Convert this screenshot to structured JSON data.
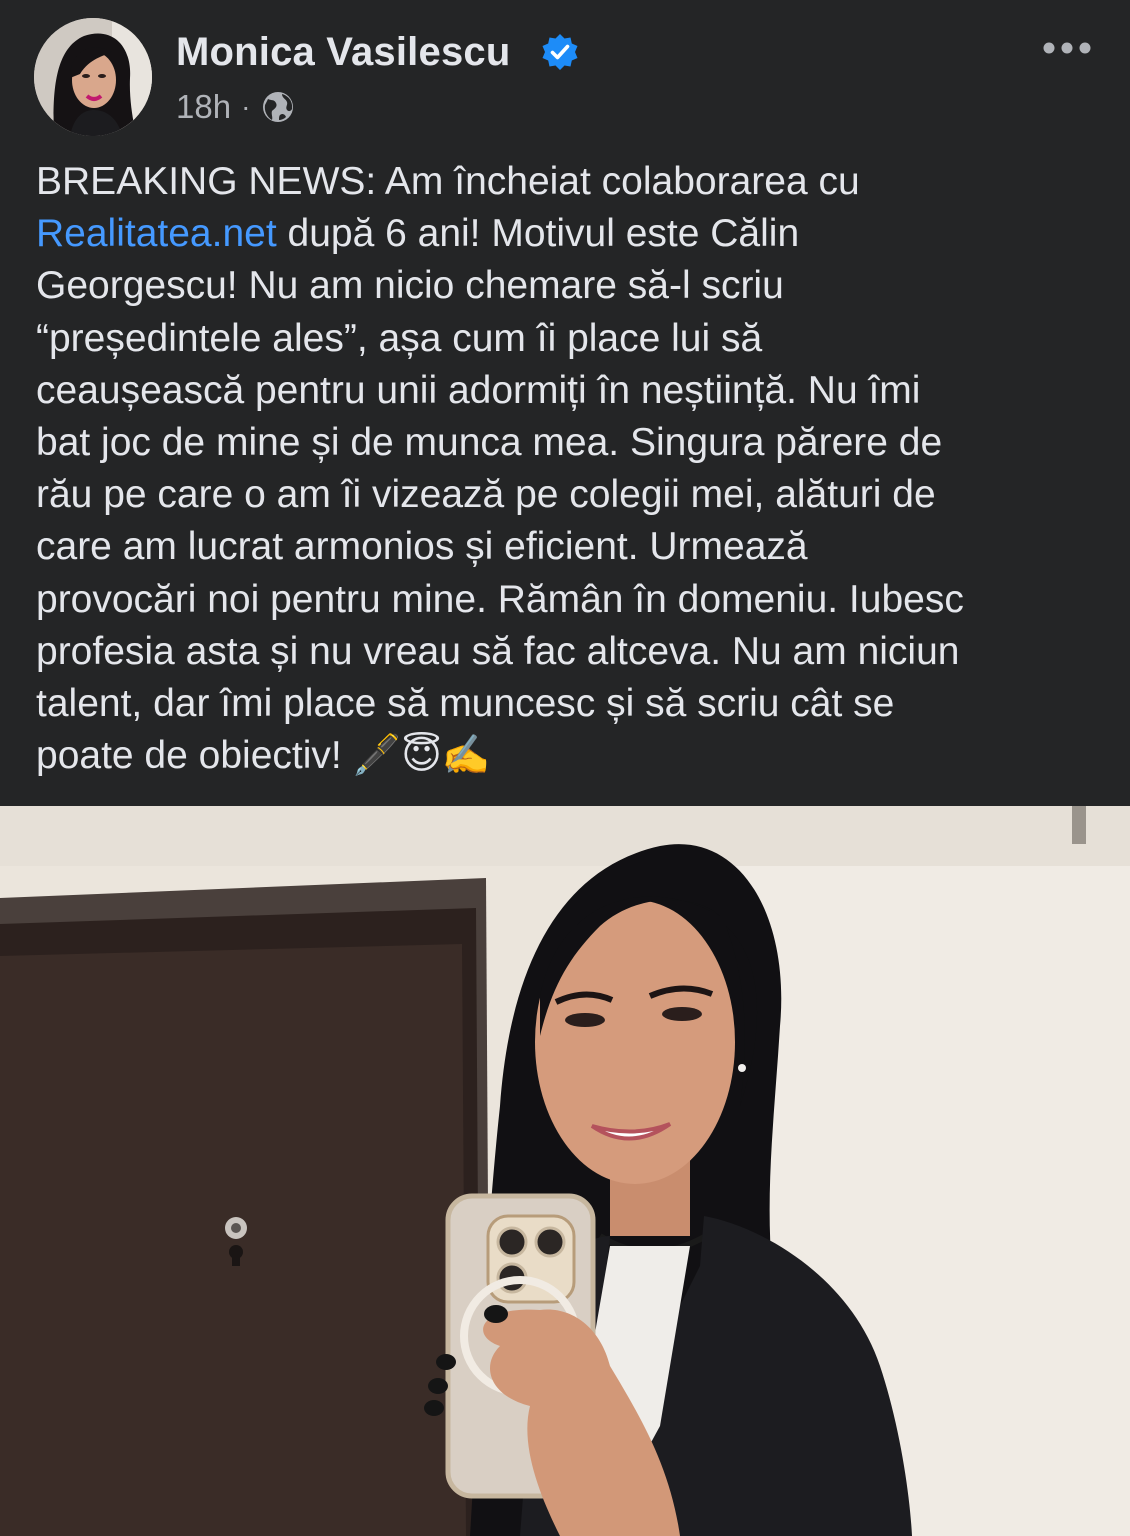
{
  "post": {
    "author_name": "Monica Vasilescu",
    "time": "18h",
    "separator": "·",
    "privacy_icon": "globe-icon",
    "verified_icon": "verified-badge-icon",
    "more_icon": "more-options-icon"
  },
  "text": {
    "line1": "BREAKING NEWS: Am încheiat colaborarea cu",
    "line2_link": "Realitatea.net",
    "line2_rest": " după 6 ani! Motivul este Călin",
    "line3": "Georgescu!  Nu am nicio chemare să-l scriu",
    "line4": "“președintele ales”, așa cum îi place lui să",
    "line5": "ceaușească pentru unii adormiți în neștiință. Nu îmi",
    "line6": "bat joc de mine și de munca mea. Singura părere de",
    "line7": "rău pe care o am îi vizează pe colegii mei, alături de",
    "line8": "care am lucrat armonios și eficient. Urmează",
    "line9": "provocări noi pentru mine. Rămân în domeniu. Iubesc",
    "line10": "profesia asta și nu vreau să fac altceva. Nu am niciun",
    "line11": "talent, dar îmi place să muncesc și să scriu cât se",
    "line12": "poate de obiectiv! ",
    "emojis": [
      "🖋️",
      "😇",
      "✍️"
    ]
  },
  "colors": {
    "background": "#242526",
    "text": "#e4e6eb",
    "secondary_text": "#b0b3b8",
    "link": "#4599ff",
    "verified": "#1d8cf8"
  }
}
